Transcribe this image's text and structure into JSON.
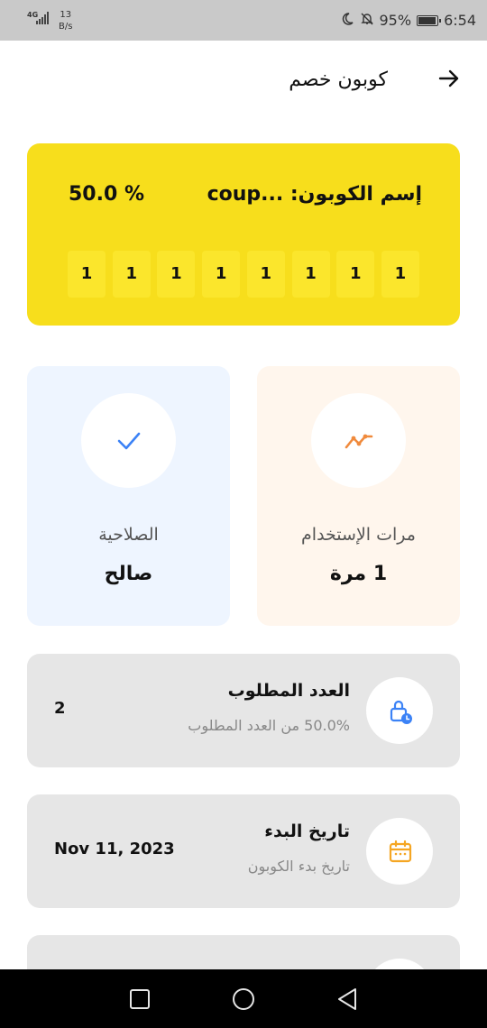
{
  "status_bar": {
    "network": "4G",
    "speed_value": "13",
    "speed_unit": "B/s",
    "battery": "95%",
    "time": "6:54"
  },
  "header": {
    "title": "كوبون خصم",
    "back_icon": "arrow-right-icon"
  },
  "coupon": {
    "name_label": "إسم الكوبون: ...coup",
    "discount": "50.0 %",
    "code_chars": [
      "1",
      "1",
      "1",
      "1",
      "1",
      "1",
      "1",
      "1"
    ],
    "background": "#f7de1c"
  },
  "stats": {
    "usage": {
      "label": "مرات الإستخدام",
      "value": "1 مرة",
      "icon": "trend-line-icon",
      "color": "#f08a3c"
    },
    "validity": {
      "label": "الصلاحية",
      "value": "صالح",
      "icon": "check-icon",
      "color": "#3b82f6"
    }
  },
  "info": [
    {
      "title": "العدد المطلوب",
      "subtitle": "50.0% من العدد المطلوب",
      "value": "2",
      "icon": "lock-clock-icon",
      "color": "#3b82f6"
    },
    {
      "title": "تاريخ البدء",
      "subtitle": "تاريخ بدء الكوبون",
      "value": "Nov 11, 2023",
      "icon": "calendar-icon",
      "color": "#f5a623"
    }
  ],
  "nav": [
    "recents-icon",
    "home-icon",
    "back-icon"
  ]
}
